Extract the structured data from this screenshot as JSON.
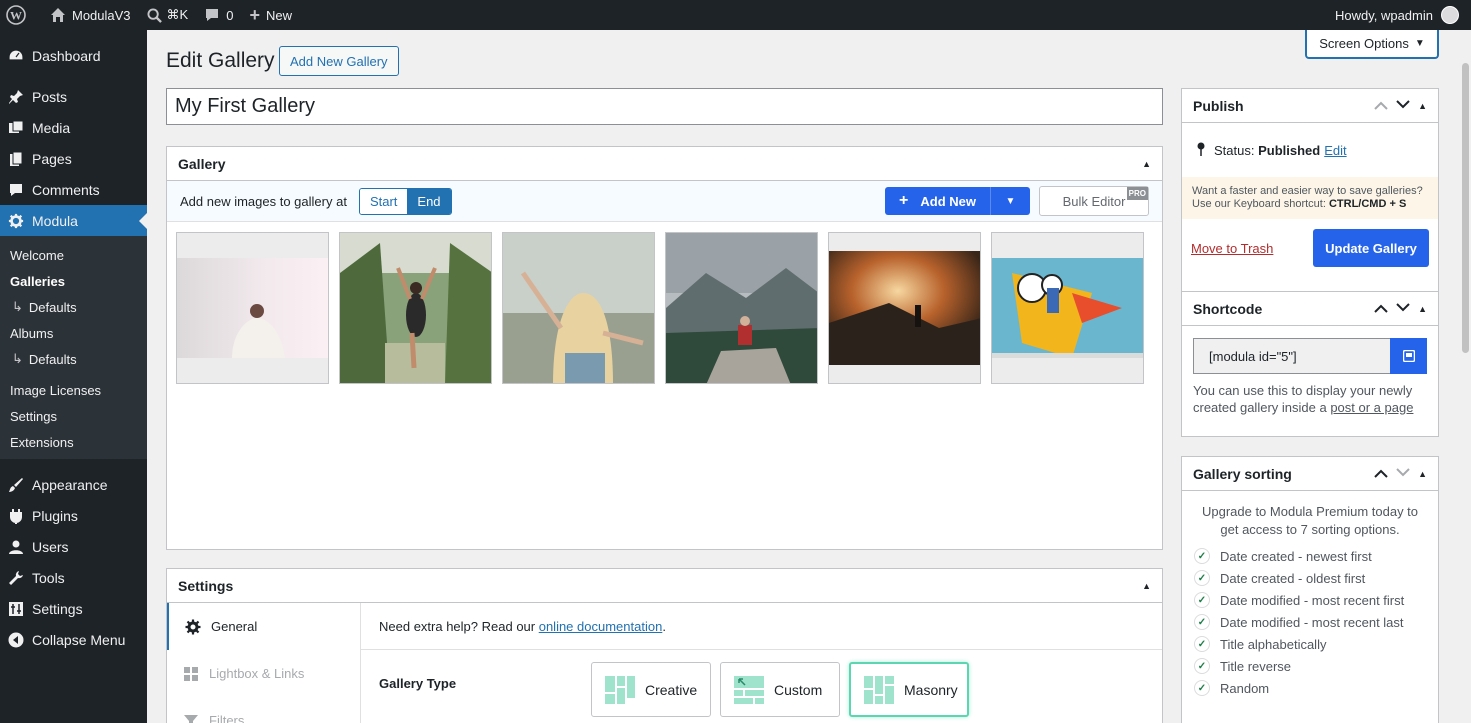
{
  "adminbar": {
    "site_name": "ModulaV3",
    "search_shortcut": "⌘K",
    "comments_count": "0",
    "new_label": "New",
    "howdy": "Howdy, wpadmin"
  },
  "sidebar": {
    "dashboard": "Dashboard",
    "posts": "Posts",
    "media": "Media",
    "pages": "Pages",
    "comments": "Comments",
    "modula": "Modula",
    "sub": {
      "welcome": "Welcome",
      "galleries": "Galleries",
      "defaults1": "Defaults",
      "albums": "Albums",
      "defaults2": "Defaults",
      "image_licenses": "Image Licenses",
      "settings": "Settings",
      "extensions": "Extensions"
    },
    "appearance": "Appearance",
    "plugins": "Plugins",
    "users": "Users",
    "tools": "Tools",
    "settings": "Settings",
    "collapse": "Collapse Menu"
  },
  "header": {
    "screen_options": "Screen Options",
    "page_title": "Edit Gallery",
    "add_new_gallery": "Add New Gallery",
    "gallery_title": "My First Gallery"
  },
  "gallery_box": {
    "title": "Gallery",
    "add_images_at": "Add new images to gallery at",
    "start": "Start",
    "end": "End",
    "add_new": "Add New",
    "bulk_editor": "Bulk Editor",
    "pro": "PRO"
  },
  "settings_box": {
    "title": "Settings",
    "tabs": [
      "General",
      "Lightbox & Links",
      "Filters"
    ],
    "help_prefix": "Need extra help? Read our ",
    "help_link": "online documentation",
    "help_suffix": ".",
    "gallery_type_label": "Gallery Type",
    "types": [
      "Creative",
      "Custom",
      "Masonry"
    ],
    "selected_type": "Masonry"
  },
  "publish": {
    "title": "Publish",
    "status_label": "Status: ",
    "status_value": "Published",
    "edit": "Edit",
    "tip_line1": "Want a faster and easier way to save galleries?",
    "tip_line2_prefix": "Use our Keyboard shortcut: ",
    "tip_shortcut": "CTRL/CMD + S",
    "move_to_trash": "Move to Trash",
    "update": "Update Gallery"
  },
  "shortcode": {
    "title": "Shortcode",
    "value": "[modula id=\"5\"]",
    "desc_prefix": "You can use this to display your newly created gallery inside a ",
    "desc_link": "post or a page"
  },
  "sorting": {
    "title": "Gallery sorting",
    "intro": "Upgrade to Modula Premium today to get access to 7 sorting options.",
    "options": [
      "Date created - newest first",
      "Date created - oldest first",
      "Date modified - most recent first",
      "Date modified - most recent last",
      "Title alphabetically",
      "Title reverse",
      "Random"
    ]
  }
}
